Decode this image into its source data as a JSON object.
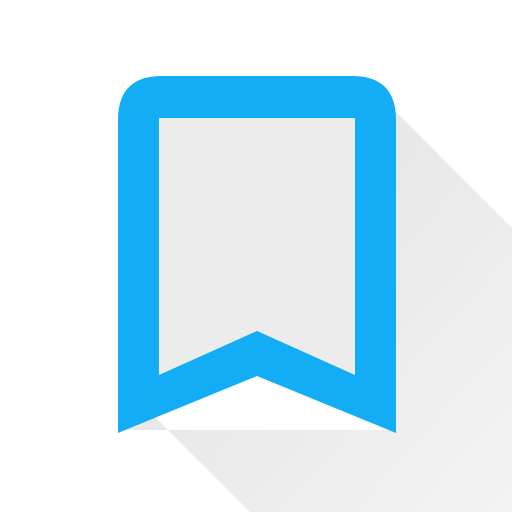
{
  "icon": {
    "name": "bookmark-icon",
    "colors": {
      "outline": "#12adf5",
      "fill": "#ececec",
      "background": "#ffffff",
      "long_shadow": "#e8e8e8"
    }
  }
}
